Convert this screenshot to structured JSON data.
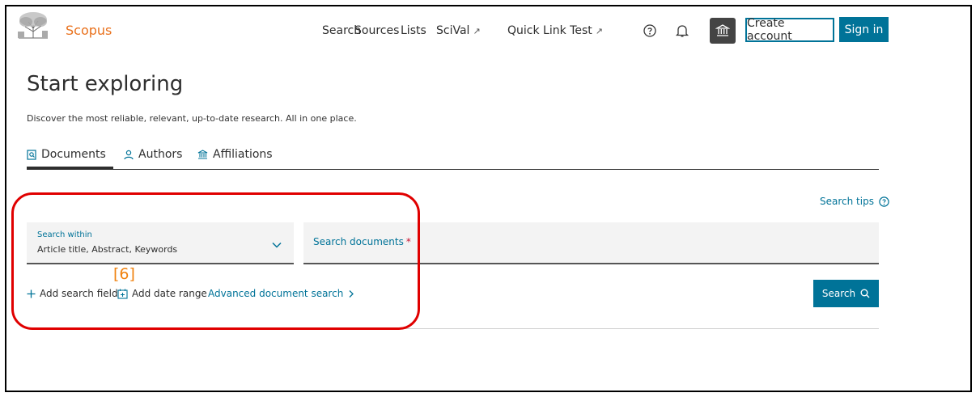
{
  "header": {
    "brand": "Scopus",
    "nav": [
      {
        "label": "Search",
        "external": false
      },
      {
        "label": "Sources",
        "external": false
      },
      {
        "label": "Lists",
        "external": false
      },
      {
        "label": "SciVal",
        "external": true
      },
      {
        "label": "Quick Link Test",
        "external": true
      }
    ],
    "external_glyph": "↗",
    "icons": [
      "help-icon",
      "bell-icon",
      "institution-icon"
    ],
    "create_account": "Create account",
    "sign_in": "Sign in"
  },
  "main": {
    "title": "Start exploring",
    "subtitle": "Discover the most reliable, relevant, up-to-date research. All in one place.",
    "tabs": [
      {
        "label": "Documents",
        "icon": "document-icon",
        "active": true
      },
      {
        "label": "Authors",
        "icon": "person-icon",
        "active": false
      },
      {
        "label": "Affiliations",
        "icon": "institution-icon",
        "active": false
      }
    ],
    "search_tips": "Search tips",
    "search_within": {
      "label": "Search within",
      "value": "Article title, Abstract, Keywords"
    },
    "search_documents": {
      "placeholder": "Search documents",
      "required_mark": "*"
    },
    "add_search_field": "Add search field",
    "add_date_range": "Add date range",
    "advanced_search": "Advanced document search",
    "search_button": "Search"
  },
  "annotation": {
    "label": "[6]"
  },
  "colors": {
    "accent": "#007398",
    "brand": "#e9711c",
    "annotation_box": "#e00000",
    "annotation_label": "#f0820f"
  }
}
